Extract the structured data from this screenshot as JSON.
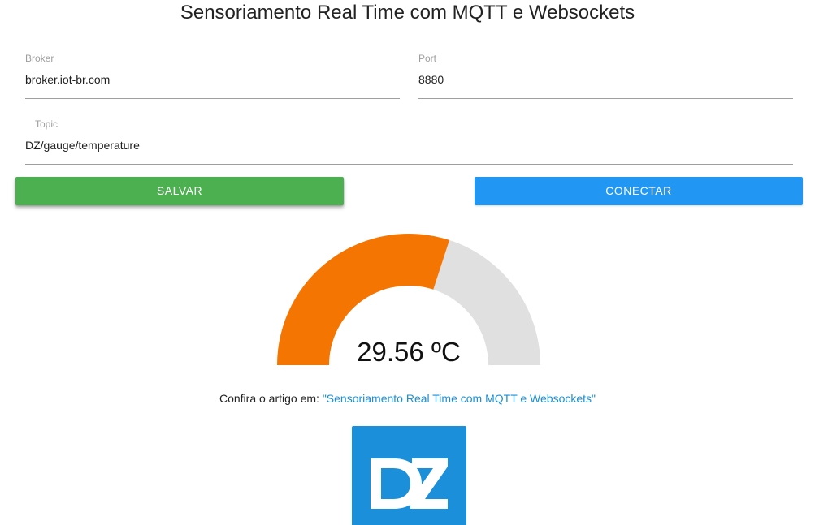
{
  "header": {
    "title": "Sensoriamento Real Time com MQTT e Websockets"
  },
  "form": {
    "broker": {
      "label": "Broker",
      "value": "broker.iot-br.com"
    },
    "port": {
      "label": "Port",
      "value": "8880"
    },
    "topic": {
      "label": "Topic",
      "value": "DZ/gauge/temperature"
    }
  },
  "buttons": {
    "save_label": "SALVAR",
    "connect_label": "CONECTAR"
  },
  "gauge": {
    "value_text": "29.56 ºC",
    "fill_fraction": 0.6,
    "fill_color": "#f57503",
    "track_color": "#e0e0e0"
  },
  "article": {
    "prefix": "Confira o artigo em: ",
    "link_text": "\"Sensoriamento Real Time com MQTT e Websockets\""
  },
  "logo": {
    "text": "DZ",
    "color": "#1b8fd9"
  },
  "colors": {
    "save_button": "#4caf50",
    "connect_button": "#2196f3",
    "link": "#1a8fd4"
  }
}
